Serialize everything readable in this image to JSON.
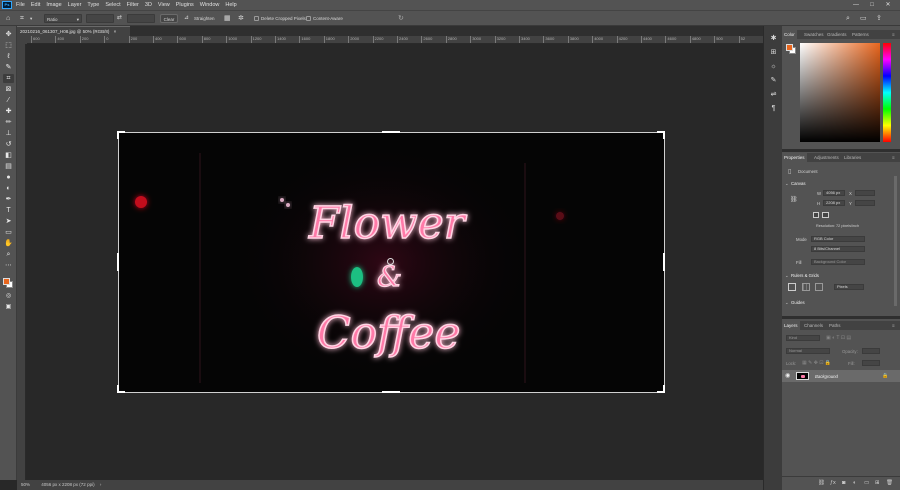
{
  "menubar": {
    "logo": "Ps",
    "items": [
      "File",
      "Edit",
      "Image",
      "Layer",
      "Type",
      "Select",
      "Filter",
      "3D",
      "View",
      "Plugins",
      "Window",
      "Help"
    ],
    "minimize": "—",
    "maximize": "□",
    "close": "✕"
  },
  "options": {
    "ratio_label": "Ratio",
    "clear_label": "Clear",
    "straighten_label": "Straighten",
    "delete_cropped_label": "Delete Cropped Pixels",
    "content_aware_label": "Content-Aware"
  },
  "document": {
    "tab_title": "20210216_061307_H08.jpg @ 50% (RGB/8)",
    "close_glyph": "×"
  },
  "ruler": {
    "h_ticks": [
      "600",
      "400",
      "200",
      "0",
      "200",
      "400",
      "600",
      "800",
      "1000",
      "1200",
      "1400",
      "1600",
      "1800",
      "2000",
      "2200",
      "2400",
      "2600",
      "2800",
      "3000",
      "3200",
      "3400",
      "3600",
      "3800",
      "4000",
      "4200",
      "4400",
      "4600",
      "4800",
      "500",
      "52"
    ]
  },
  "status": {
    "zoom": "50%",
    "dimensions": "4056 px x 2208 px (72 ppi)",
    "arrow": "›"
  },
  "photo": {
    "sign_line1": "Flower",
    "sign_line2": "&",
    "sign_line3": "Coffee"
  },
  "color_panel": {
    "tabs": [
      "Color",
      "Swatches",
      "Gradients",
      "Patterns"
    ],
    "foreground": "#e8661e",
    "background": "#ffffff"
  },
  "properties_panel": {
    "tabs": [
      "Properties",
      "Adjustments",
      "Libraries"
    ],
    "doc_label": "Document",
    "canvas_section": "Canvas",
    "w_label": "W",
    "w_value": "4056 px",
    "h_label": "H",
    "h_value": "2208 px",
    "x_label": "X",
    "y_label": "Y",
    "resolution": "Resolution: 72 pixels/inch",
    "mode_label": "Mode",
    "mode_value": "RGB Color",
    "depth_value": "8 Bits/Channel",
    "fill_label": "Fill",
    "fill_value": "Background Color",
    "rulers_section": "Rulers & Grids",
    "units_value": "Pixels",
    "guides_section": "Guides"
  },
  "layers_panel": {
    "tabs": [
      "Layers",
      "Channels",
      "Paths"
    ],
    "kind_placeholder": "Kind",
    "blend_value": "Normal",
    "opacity_label": "Opacity:",
    "lock_label": "Lock:",
    "fill_label": "Fill:",
    "layer_name": "Background"
  }
}
